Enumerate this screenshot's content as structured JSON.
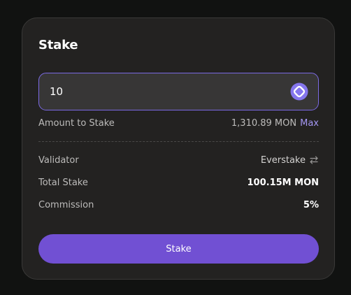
{
  "card": {
    "title": "Stake"
  },
  "amount": {
    "value": "10",
    "token_icon": "monad-token-icon",
    "label": "Amount to Stake",
    "balance": "1,310.89 MON",
    "max_label": "Max"
  },
  "details": {
    "validator_label": "Validator",
    "validator_value": "Everstake",
    "validator_icon": "swap-arrows-icon",
    "total_stake_label": "Total Stake",
    "total_stake_value": "100.15M MON",
    "commission_label": "Commission",
    "commission_value": "5%"
  },
  "actions": {
    "stake_label": "Stake"
  },
  "colors": {
    "accent": "#7150d3",
    "input_border": "#7b6ae3",
    "max_link": "#a396f2",
    "card_bg": "#232221",
    "page_bg": "#111211"
  }
}
